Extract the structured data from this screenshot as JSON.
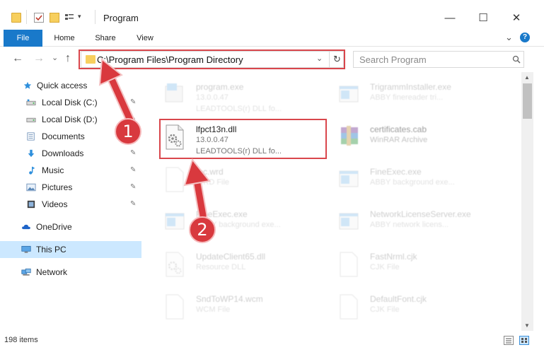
{
  "window": {
    "title": "Program",
    "minimize_glyph": "—",
    "maximize_glyph": "☐",
    "close_glyph": "✕"
  },
  "ribbon": {
    "tabs": [
      "File",
      "Home",
      "Share",
      "View"
    ],
    "expand_glyph": "⌄",
    "help_glyph": "?"
  },
  "address": {
    "path": "C:\\Program Files\\Program Directory",
    "dropdown_glyph": "⌄",
    "refresh_glyph": "↻",
    "back_glyph": "←",
    "forward_glyph": "→",
    "recent_glyph": "⌄",
    "up_glyph": "↑"
  },
  "search": {
    "placeholder": "Search Program",
    "icon": "search-icon"
  },
  "sidebar": {
    "items": [
      {
        "label": "Quick access",
        "icon": "star-icon",
        "pinned": false
      },
      {
        "label": "Local Disk (C:)",
        "icon": "drive-icon",
        "pinned": true
      },
      {
        "label": "Local Disk (D:)",
        "icon": "drive-icon",
        "pinned": true
      },
      {
        "label": "Documents",
        "icon": "documents-icon",
        "pinned": true
      },
      {
        "label": "Downloads",
        "icon": "downloads-icon",
        "pinned": true
      },
      {
        "label": "Music",
        "icon": "music-icon",
        "pinned": true
      },
      {
        "label": "Pictures",
        "icon": "pictures-icon",
        "pinned": true
      },
      {
        "label": "Videos",
        "icon": "videos-icon",
        "pinned": true
      },
      {
        "label": "OneDrive",
        "icon": "cloud-icon",
        "pinned": false
      },
      {
        "label": "This PC",
        "icon": "computer-icon",
        "pinned": false,
        "selected": true
      },
      {
        "label": "Network",
        "icon": "network-icon",
        "pinned": false
      }
    ],
    "pin_glyph": "📌"
  },
  "files": [
    {
      "name": "program.exe",
      "line1": "13.0.0.47",
      "line2": "LEADTOOLS(r) DLL fo...",
      "icon": "exe-icon",
      "dim": true
    },
    {
      "name": "TrigrammInstaller.exe",
      "line1": "ABBY finereader tri...",
      "line2": "",
      "icon": "exe-icon",
      "dim": true
    },
    {
      "name": "lfpct13n.dll",
      "line1": "13.0.0.47",
      "line2": "LEADTOOLS(r) DLL fo...",
      "icon": "dll-gear-icon",
      "dim": false
    },
    {
      "name": "certificates.cab",
      "line1": "WinRAR Archive",
      "line2": "",
      "icon": "archive-icon",
      "dim": true
    },
    {
      "name": "tbc.wrd",
      "line1": "WRD File",
      "line2": "",
      "icon": "file-icon",
      "dim": true
    },
    {
      "name": "FineExec.exe",
      "line1": "ABBY background exe...",
      "line2": "",
      "icon": "exe-icon",
      "dim": true
    },
    {
      "name": "FineExec.exe",
      "line1": "ABBY background exe...",
      "line2": "",
      "icon": "exe-icon",
      "dim": true
    },
    {
      "name": "NetworkLicenseServer.exe",
      "line1": "ABBY network licens...",
      "line2": "",
      "icon": "exe-icon",
      "dim": true
    },
    {
      "name": "UpdateClient65.dll",
      "line1": "Resource DLL",
      "line2": "",
      "icon": "dll-gear-icon",
      "dim": true
    },
    {
      "name": "FastNrml.cjk",
      "line1": "CJK File",
      "line2": "",
      "icon": "file-icon",
      "dim": true
    },
    {
      "name": "SndToWP14.wcm",
      "line1": "WCM File",
      "line2": "",
      "icon": "file-icon",
      "dim": true
    },
    {
      "name": "DefaultFont.cjk",
      "line1": "CJK File",
      "line2": "",
      "icon": "file-icon",
      "dim": true
    }
  ],
  "status": {
    "item_count": "198 items"
  },
  "annotations": {
    "step1": "1",
    "step2": "2",
    "accent_color": "#d9393e"
  }
}
